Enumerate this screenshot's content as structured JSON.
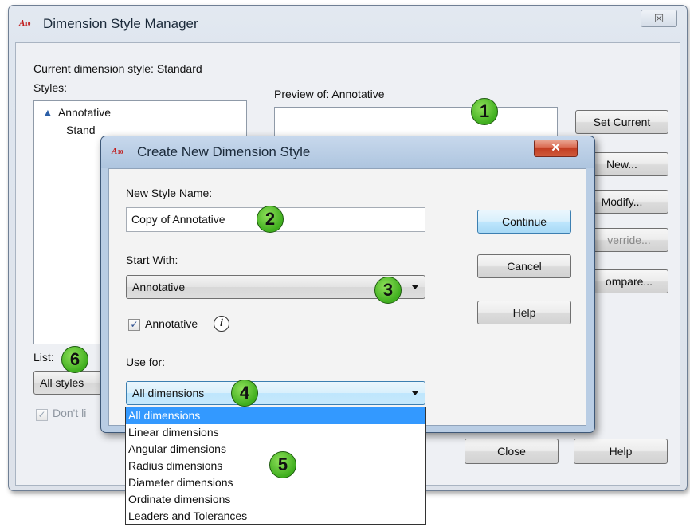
{
  "main_window": {
    "title": "Dimension Style Manager",
    "close_glyph": "☒",
    "current_style_label": "Current dimension style: Standard",
    "styles_label": "Styles:",
    "styles": [
      "Annotative",
      "Standard"
    ],
    "styles_visible_second": "Stand",
    "preview_label": "Preview of: Annotative",
    "list_label": "List:",
    "list_value": "All styles",
    "dont_list_label": "Don't li",
    "buttons": {
      "set_current": "Set Current",
      "new": "New...",
      "modify": "Modify...",
      "override": "verride...",
      "compare": "ompare...",
      "close": "Close",
      "help": "Help"
    }
  },
  "dialog": {
    "title": "Create New Dimension Style",
    "close_glyph": "✕",
    "new_style_name_label": "New Style Name:",
    "new_style_name_value": "Copy of Annotative",
    "start_with_label": "Start With:",
    "start_with_value": "Annotative",
    "annotative_label": "Annotative",
    "annotative_checked": true,
    "use_for_label": "Use for:",
    "use_for_value": "All dimensions",
    "buttons": {
      "continue": "Continue",
      "cancel": "Cancel",
      "help": "Help"
    }
  },
  "use_for_options": [
    "All dimensions",
    "Linear dimensions",
    "Angular dimensions",
    "Radius dimensions",
    "Diameter dimensions",
    "Ordinate dimensions",
    "Leaders and Tolerances"
  ],
  "callouts": [
    "1",
    "2",
    "3",
    "4",
    "5",
    "6"
  ],
  "icons": {
    "app": "autocad-app-icon",
    "annotative": "annotative-scale-icon",
    "info": "info-icon"
  },
  "colors": {
    "callout_green": "#3fae1e",
    "selection_blue": "#3399ff",
    "close_red": "#c23e22"
  }
}
